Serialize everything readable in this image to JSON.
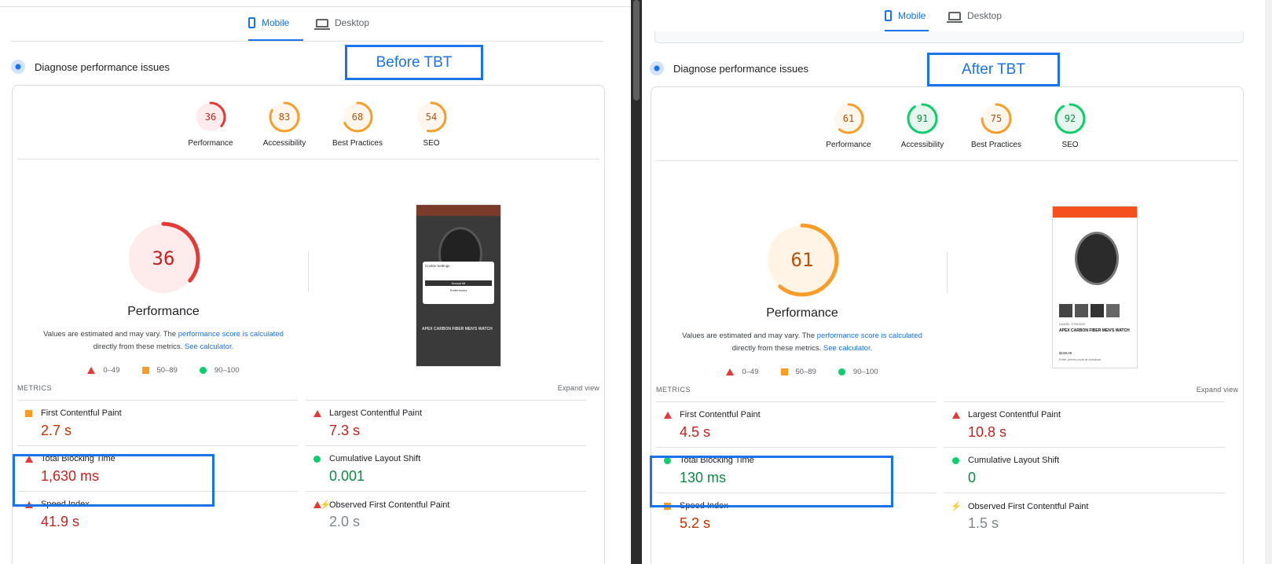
{
  "left": {
    "tabs": {
      "mobile": "Mobile",
      "desktop": "Desktop"
    },
    "diagnose": "Diagnose performance issues",
    "callout": "Before TBT",
    "scores": [
      {
        "label": "Performance",
        "value": "36",
        "pct": 36,
        "color": "#e53935",
        "text_color": "#c5221f",
        "bg": "#fdeceb"
      },
      {
        "label": "Accessibility",
        "value": "83",
        "pct": 83,
        "color": "#fa9d28",
        "text_color": "#b45309",
        "bg": "#fff7ed"
      },
      {
        "label": "Best Practices",
        "value": "68",
        "pct": 68,
        "color": "#fa9d28",
        "text_color": "#b45309",
        "bg": "#fff7ed"
      },
      {
        "label": "SEO",
        "value": "54",
        "pct": 54,
        "color": "#fa9d28",
        "text_color": "#b45309",
        "bg": "#fff7ed"
      }
    ],
    "perf_big": {
      "value": "36",
      "pct": 36,
      "color": "#e53935",
      "text_color": "#c5221f",
      "bg": "#fdeceb",
      "title": "Performance"
    },
    "metrics": [
      {
        "name": "First Contentful Paint",
        "value": "2.7 s",
        "rating": "average"
      },
      {
        "name": "Largest Contentful Paint",
        "value": "7.3 s",
        "rating": "poor"
      },
      {
        "name": "Total Blocking Time",
        "value": "1,630 ms",
        "rating": "poor"
      },
      {
        "name": "Cumulative Layout Shift",
        "value": "0.001",
        "rating": "good"
      },
      {
        "name": "Speed Index",
        "value": "41.9 s",
        "rating": "poor"
      },
      {
        "name": "Observed First Contentful Paint",
        "value": "2.0 s",
        "rating": "observed-poor"
      }
    ],
    "thumbnail": {
      "cookie_title": "Cookie Settings",
      "accept": "Accept All",
      "preferences": "Preferences",
      "product": "APEX CARBON FIBER MEN'S WATCH"
    }
  },
  "right": {
    "tabs": {
      "mobile": "Mobile",
      "desktop": "Desktop"
    },
    "diagnose": "Diagnose performance issues",
    "callout": "After TBT",
    "scores": [
      {
        "label": "Performance",
        "value": "61",
        "pct": 61,
        "color": "#fa9d28",
        "text_color": "#b45309",
        "bg": "#fff7ed"
      },
      {
        "label": "Accessibility",
        "value": "91",
        "pct": 91,
        "color": "#0cce6b",
        "text_color": "#0d8843",
        "bg": "#e6f6ee"
      },
      {
        "label": "Best Practices",
        "value": "75",
        "pct": 75,
        "color": "#fa9d28",
        "text_color": "#b45309",
        "bg": "#fff7ed"
      },
      {
        "label": "SEO",
        "value": "92",
        "pct": 92,
        "color": "#0cce6b",
        "text_color": "#0d8843",
        "bg": "#e6f6ee"
      }
    ],
    "perf_big": {
      "value": "61",
      "pct": 61,
      "color": "#fa9d28",
      "text_color": "#b45309",
      "bg": "#fff4e6",
      "title": "Performance"
    },
    "metrics": [
      {
        "name": "First Contentful Paint",
        "value": "4.5 s",
        "rating": "poor"
      },
      {
        "name": "Largest Contentful Paint",
        "value": "10.8 s",
        "rating": "poor"
      },
      {
        "name": "Total Blocking Time",
        "value": "130 ms",
        "rating": "good"
      },
      {
        "name": "Cumulative Layout Shift",
        "value": "0",
        "rating": "good"
      },
      {
        "name": "Speed Index",
        "value": "5.2 s",
        "rating": "average"
      },
      {
        "name": "Observed First Contentful Paint",
        "value": "1.5 s",
        "rating": "observed"
      }
    ],
    "thumbnail": {
      "brand": "DANIEL STEIGER",
      "product": "APEX CARBON FIBER MEN'S WATCH",
      "price": "$199.00",
      "promo": "Enter promo code at checkout"
    }
  },
  "shared": {
    "desc_prefix": "Values are estimated and may vary. The ",
    "desc_link1": "performance score is calculated",
    "desc_mid": "directly from these metrics. ",
    "desc_link2": "See calculator.",
    "legend": [
      "0–49",
      "50–89",
      "90–100"
    ],
    "metrics_label": "METRICS",
    "expand_view": "Expand view"
  }
}
